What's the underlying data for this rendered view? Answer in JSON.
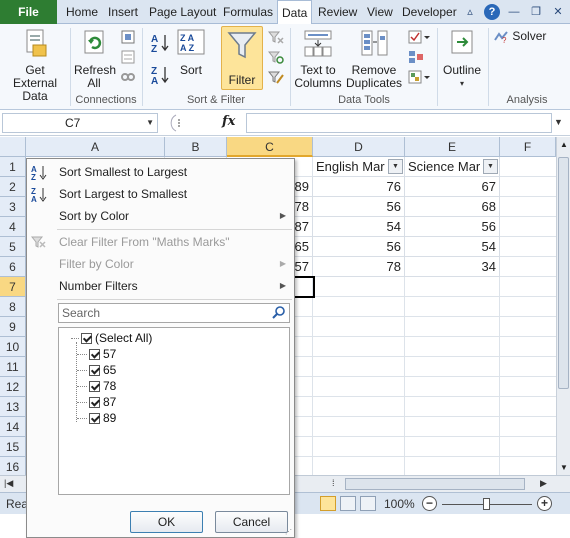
{
  "ribbon_tabs": {
    "file": "File",
    "tabs": [
      "Home",
      "Insert",
      "Page Layout",
      "Formulas",
      "Data",
      "Review",
      "View",
      "Developer"
    ],
    "active": "Data"
  },
  "ribbon": {
    "get_external_data": "Get External Data",
    "refresh_all": "Refresh All",
    "connections_group": "Connections",
    "sort_az": "A↓Z",
    "sort": "Sort",
    "filter": "Filter",
    "sort_filter_group": "Sort & Filter",
    "text_to_columns": "Text to Columns",
    "remove_duplicates": "Remove Duplicates",
    "data_tools_group": "Data Tools",
    "outline": "Outline",
    "solver": "Solver",
    "analysis_group": "Analysis"
  },
  "formula_bar": {
    "name_box": "C7",
    "fx": "fx",
    "formula": ""
  },
  "sheet": {
    "columns": [
      "A",
      "B",
      "C",
      "D",
      "E",
      "F"
    ],
    "selected_column": "C",
    "rows": [
      "1",
      "2",
      "3",
      "4",
      "5",
      "6",
      "7",
      "8",
      "9",
      "10",
      "11",
      "12",
      "13",
      "14",
      "15",
      "16"
    ],
    "selected_row": "7",
    "headers": {
      "D": "English Mar",
      "E": "Science Mar"
    },
    "col_c": [
      "89",
      "78",
      "87",
      "65",
      "57"
    ],
    "col_d": [
      "76",
      "56",
      "54",
      "56",
      "78"
    ],
    "col_e": [
      "67",
      "68",
      "56",
      "54",
      "34"
    ]
  },
  "filter_menu": {
    "sort_asc": "Sort Smallest to Largest",
    "sort_desc": "Sort Largest to Smallest",
    "sort_color": "Sort by Color",
    "clear_filter": "Clear Filter From \"Maths Marks\"",
    "filter_color": "Filter by Color",
    "number_filters": "Number Filters",
    "search_placeholder": "Search",
    "select_all": "(Select All)",
    "values": [
      "57",
      "65",
      "78",
      "87",
      "89"
    ],
    "ok": "OK",
    "cancel": "Cancel"
  },
  "status_bar": {
    "ready": "Rea",
    "zoom": "100%",
    "zoom_level": 1.0
  }
}
